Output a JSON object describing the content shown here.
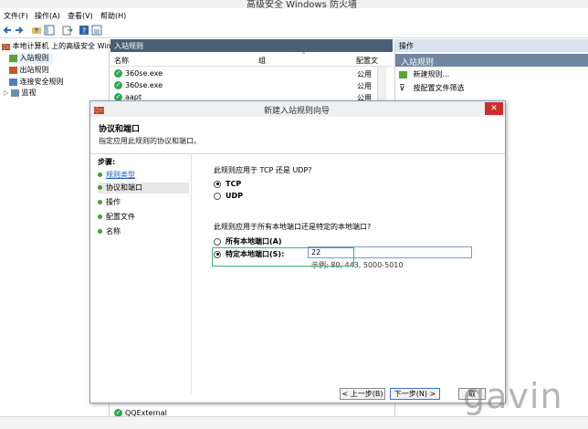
{
  "window": {
    "title": "高级安全 Windows 防火墙"
  },
  "menu": [
    "文件(F)",
    "操作(A)",
    "查看(V)",
    "帮助(H)"
  ],
  "tree": {
    "root": "本地计算机 上的高级安全 Win",
    "items": [
      "入站规则",
      "出站规则",
      "连接安全规则",
      "监视"
    ]
  },
  "center": {
    "header": "入站规则",
    "columns": [
      "名称",
      "组",
      "配置文"
    ],
    "rows": [
      {
        "name": "360se.exe",
        "profile": "公用"
      },
      {
        "name": "360se.exe",
        "profile": "公用"
      },
      {
        "name": "aapt",
        "profile": "公用"
      }
    ],
    "bottom_row": "QQExternal"
  },
  "actions": {
    "header": "操作",
    "section": "入站规则",
    "items": [
      "新建规则...",
      "按配置文件筛选"
    ]
  },
  "dialog": {
    "title": "新建入站规则向导",
    "close": "✕",
    "heading": "协议和端口",
    "subheading": "指定应用此规则的协议和端口。",
    "steps_label": "步骤:",
    "steps": [
      "规则类型",
      "协议和端口",
      "操作",
      "配置文件",
      "名称"
    ],
    "q1": "此规则应用于 TCP 还是 UDP?",
    "opt_tcp": "TCP",
    "opt_udp": "UDP",
    "q2": "此规则应用于所有本地端口还是特定的本地端口?",
    "opt_all": "所有本地端口(A)",
    "opt_specific": "特定本地端口(S):",
    "port_value": "22",
    "example": "示例: 80, 443, 5000-5010",
    "btn_back": "< 上一步(B)",
    "btn_next": "下一步(N) >",
    "btn_cancel": "取"
  },
  "watermark": "gavin",
  "colors": {
    "accent": "#4a5f75",
    "selection": "#e5f3fb",
    "highlight": "#3cb371"
  }
}
